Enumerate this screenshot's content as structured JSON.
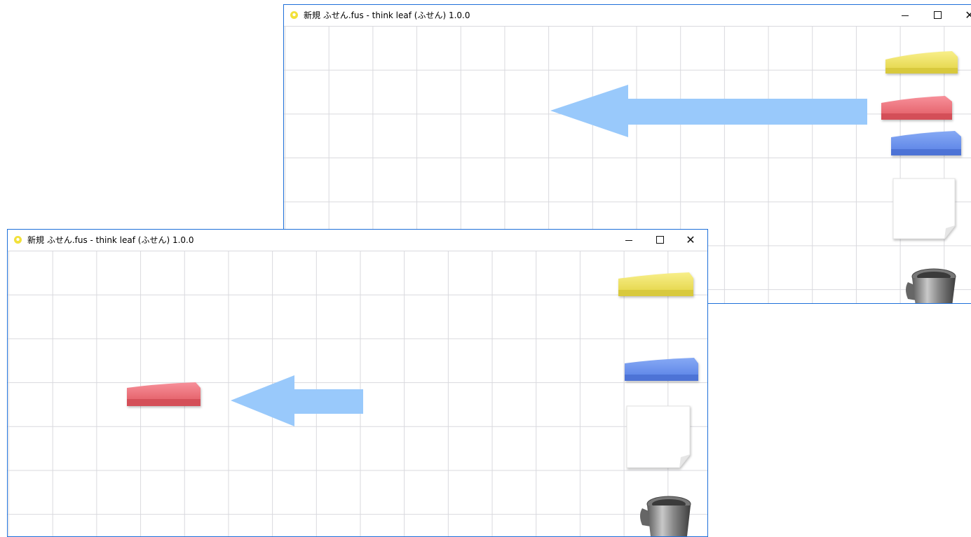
{
  "windows": [
    {
      "title": "新規 ふせん.fus - think leaf (ふせん) 1.0.0",
      "controls": {
        "minimize": "—",
        "maximize": "□",
        "close": "✕"
      }
    },
    {
      "title": "新規 ふせん.fus - think leaf (ふせん) 1.0.0",
      "controls": {
        "minimize": "—",
        "maximize": "□",
        "close": "✕"
      }
    }
  ],
  "palette": {
    "yellow": "#f3e86e",
    "red": "#f27179",
    "blue": "#6f95ee",
    "arrow": "#99c9fb",
    "grid": "#d9d9de",
    "window_border": "#1e6fd9"
  },
  "icons": [
    "yellow-sticky-pad-icon",
    "red-sticky-pad-icon",
    "blue-sticky-pad-icon",
    "blank-note-icon",
    "trash-can-icon"
  ]
}
